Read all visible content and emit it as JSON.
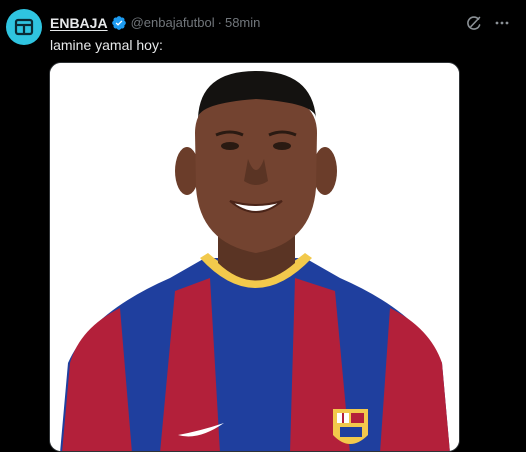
{
  "account": {
    "display_name": "ENBAJA",
    "handle": "@enbajafutbol",
    "separator": "·",
    "time": "58min"
  },
  "post": {
    "text": "lamine yamal hoy:"
  },
  "icons": {
    "avatar": "enbaja-logo-icon",
    "verified": "verified-badge-icon",
    "grok": "grok-icon",
    "more": "more-options-icon"
  },
  "colors": {
    "background": "#000000",
    "avatar": "#2fc4e0",
    "verified": "#1d9bf0",
    "muted": "#71767b",
    "text": "#e7e9ea",
    "jersey_blue": "#1f3f9e",
    "jersey_red": "#b3203a"
  }
}
